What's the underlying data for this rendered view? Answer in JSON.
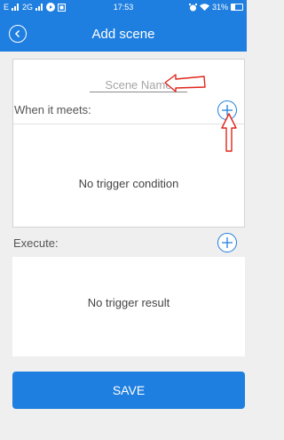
{
  "status_bar": {
    "network_left": "E",
    "network_right": "2G",
    "time": "17:53",
    "battery": "31%",
    "battery_level": 0.31
  },
  "header": {
    "title": "Add scene",
    "back_icon": "back-circle-icon"
  },
  "scene_name": {
    "placeholder": "Scene Name"
  },
  "conditions": {
    "label": "When it meets:",
    "empty_text": "No trigger condition",
    "add_icon": "plus-circle-icon"
  },
  "execute": {
    "label": "Execute:",
    "empty_text": "No trigger result",
    "add_icon": "plus-circle-icon"
  },
  "save_button": {
    "label": "SAVE"
  },
  "colors": {
    "primary": "#1f7fe0",
    "background": "#efefef",
    "annotation": "#e0261b"
  }
}
